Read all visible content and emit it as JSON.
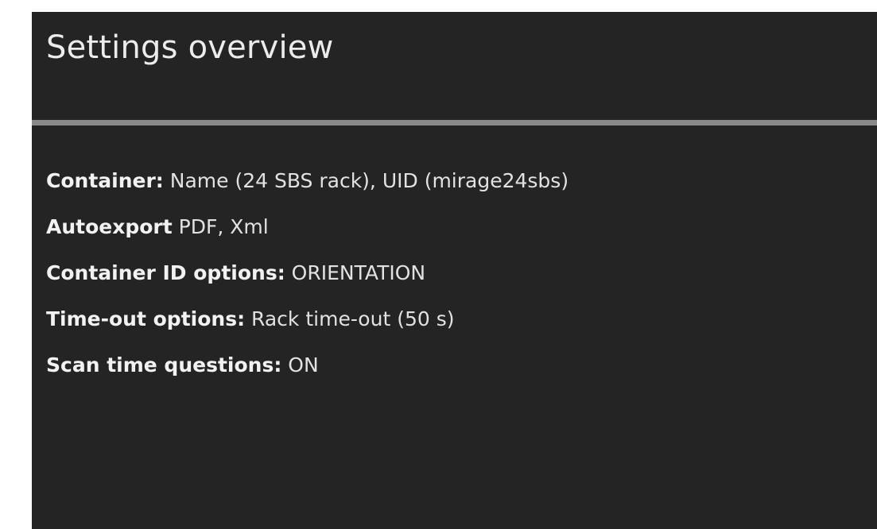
{
  "panel": {
    "title": "Settings overview"
  },
  "settings": [
    {
      "label": "Container:",
      "value": "Name (24 SBS rack), UID (mirage24sbs)"
    },
    {
      "label": "Autoexport",
      "value": "PDF, Xml"
    },
    {
      "label": "Container ID options:",
      "value": "ORIENTATION"
    },
    {
      "label": "Time-out options:",
      "value": "Rack time-out (50 s)"
    },
    {
      "label": "Scan time questions:",
      "value": "ON"
    }
  ],
  "colors": {
    "panel_background": "#242424",
    "divider": "#8a8a8a",
    "text": "#e6e6e6"
  }
}
